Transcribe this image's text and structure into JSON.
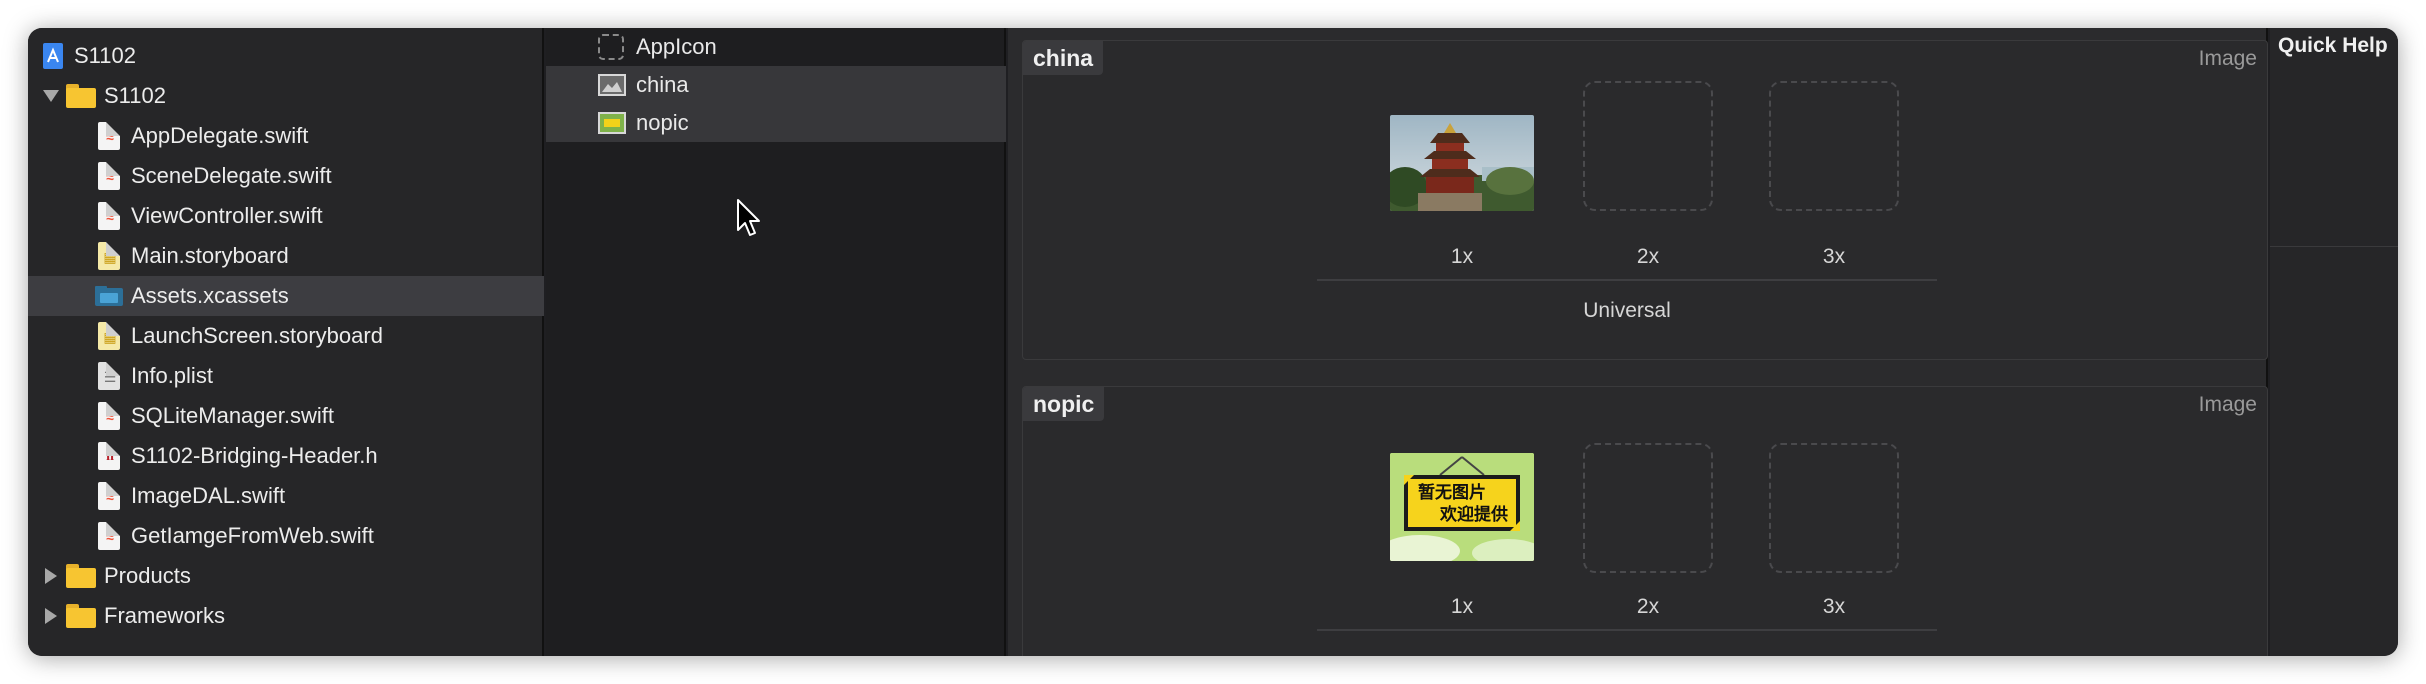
{
  "navigator": {
    "project": "S1102",
    "group": "S1102",
    "files": [
      "AppDelegate.swift",
      "SceneDelegate.swift",
      "ViewController.swift",
      "Main.storyboard",
      "Assets.xcassets",
      "LaunchScreen.storyboard",
      "Info.plist",
      "SQLiteManager.swift",
      "S1102-Bridging-Header.h",
      "ImageDAL.swift",
      "GetIamgeFromWeb.swift"
    ],
    "folders": [
      "Products",
      "Frameworks"
    ],
    "selected": "Assets.xcassets"
  },
  "asset_list": {
    "items": [
      "AppIcon",
      "china",
      "nopic"
    ]
  },
  "editor": {
    "assets": [
      {
        "name": "china",
        "type": "Image",
        "scales": [
          "1x",
          "2x",
          "3x"
        ],
        "idiom": "Universal"
      },
      {
        "name": "nopic",
        "type": "Image",
        "scales": [
          "1x",
          "2x",
          "3x"
        ],
        "image_text_line1": "暂无图片",
        "image_text_line2": "欢迎提供"
      }
    ]
  },
  "inspector": {
    "title": "Quick Help"
  },
  "colors": {
    "folder": "#f7c531",
    "swift": "#f05138",
    "selection": "#3d3d41"
  }
}
